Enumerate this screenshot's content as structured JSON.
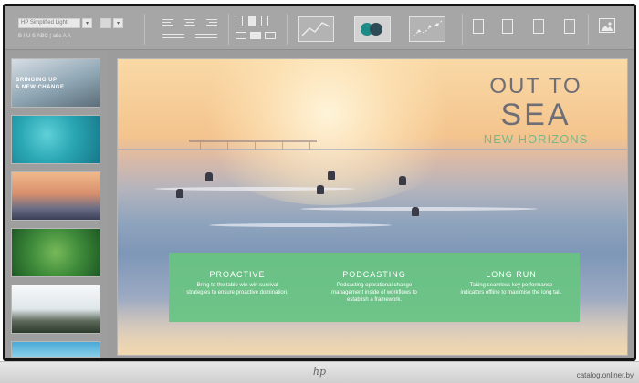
{
  "toolbar": {
    "font_name": "HP Simplified Light",
    "format_row": "B  I  U  S    ABC | abc    A  A",
    "icons": [
      "align-left-icon",
      "align-center-icon",
      "align-right-icon",
      "layout-icon",
      "line-chart-icon",
      "circles-icon",
      "scatter-chart-icon",
      "notes-icon",
      "add-slide-icon",
      "copy-icon",
      "blank-page-icon",
      "image-icon"
    ],
    "accent_colors": [
      "#2f4b55",
      "#1d8b86"
    ]
  },
  "thumbnails": [
    {
      "title": "BRINGING UP\nA NEW CHANGE"
    },
    {
      "title": ""
    },
    {
      "title": ""
    },
    {
      "title": ""
    },
    {
      "title": ""
    },
    {
      "title": ""
    }
  ],
  "slide": {
    "headline_top": "OUT TO",
    "headline_main": "SEA",
    "headline_sub": "NEW HORIZONS",
    "columns": [
      {
        "title": "PROACTIVE",
        "body": "Bring to the table win-win survival strategies to ensure proactive domination."
      },
      {
        "title": "PODCASTING",
        "body": "Podcasting operational change management inside of workflows to establish a framework."
      },
      {
        "title": "LONG RUN",
        "body": "Taking seamless key performance indicators offline to maximise the long tail."
      }
    ],
    "colors": {
      "headline": "#6e6e76",
      "subheadline": "#7ab68c",
      "panel": "#68c482"
    }
  },
  "footer": {
    "brand": "hp",
    "watermark": "catalog.onliner.by"
  }
}
